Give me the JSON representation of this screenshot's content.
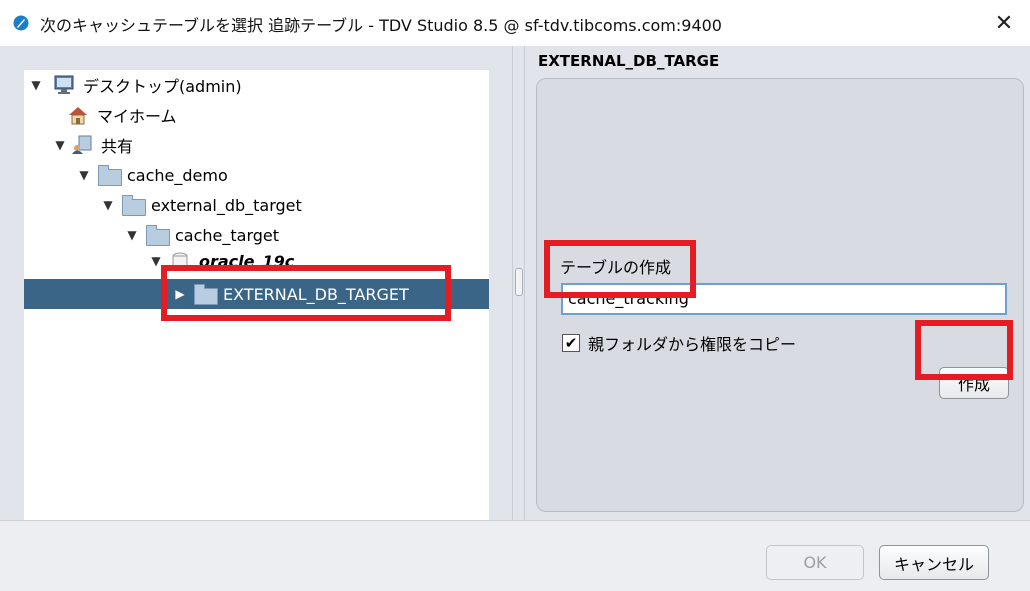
{
  "window": {
    "title": "次のキャッシュテーブルを選択 追跡テーブル - TDV Studio 8.5 @ sf-tdv.tibcoms.com:9400",
    "close_label": "✕"
  },
  "tree": {
    "items": [
      {
        "label": "デスクトップ(admin)",
        "arrow": "▼",
        "icon": "desktop-icon"
      },
      {
        "label": "マイホーム",
        "arrow": "",
        "icon": "home-icon"
      },
      {
        "label": "共有",
        "arrow": "▼",
        "icon": "shared-icon"
      },
      {
        "label": "cache_demo",
        "arrow": "▼",
        "icon": "folder-icon"
      },
      {
        "label": "external_db_target",
        "arrow": "▼",
        "icon": "folder-icon"
      },
      {
        "label": "cache_target",
        "arrow": "▼",
        "icon": "folder-icon"
      },
      {
        "label": "oracle_19c",
        "arrow": "▼",
        "icon": "database-icon"
      },
      {
        "label": "EXTERNAL_DB_TARGET",
        "arrow": "▶",
        "icon": "folder-icon",
        "selected": true
      }
    ]
  },
  "details": {
    "header": "EXTERNAL_DB_TARGE",
    "create_table_label": "テーブルの作成",
    "table_name_value": "cache_tracking",
    "copy_permissions_label": "親フォルダから権限をコピー",
    "copy_permissions_checked": true,
    "create_button": "作成"
  },
  "footer": {
    "ok_button": "OK",
    "cancel_button": "キャンセル"
  },
  "colors": {
    "selection": "#3b6587",
    "highlight": "#e41c24",
    "input_border": "#6e9fd2"
  }
}
